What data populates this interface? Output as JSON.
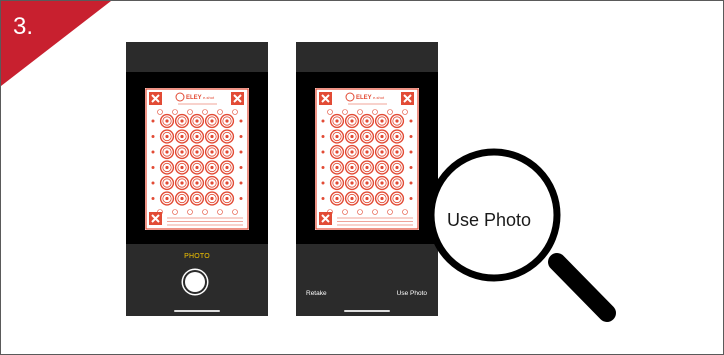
{
  "step": {
    "number": "3."
  },
  "screen_capture": {
    "mode_label": "PHOTO"
  },
  "screen_review": {
    "retake_label": "Retake",
    "use_photo_label": "Use Photo"
  },
  "magnifier": {
    "text": "Use Photo"
  },
  "target": {
    "brand": "ELEY",
    "product": "e-shot",
    "rows": 6,
    "columns": 5
  },
  "colors": {
    "accent_red": "#c8202f",
    "target_red": "#e24b35",
    "mode_yellow": "#f5c400",
    "phone_bar": "#2b2b2b"
  }
}
